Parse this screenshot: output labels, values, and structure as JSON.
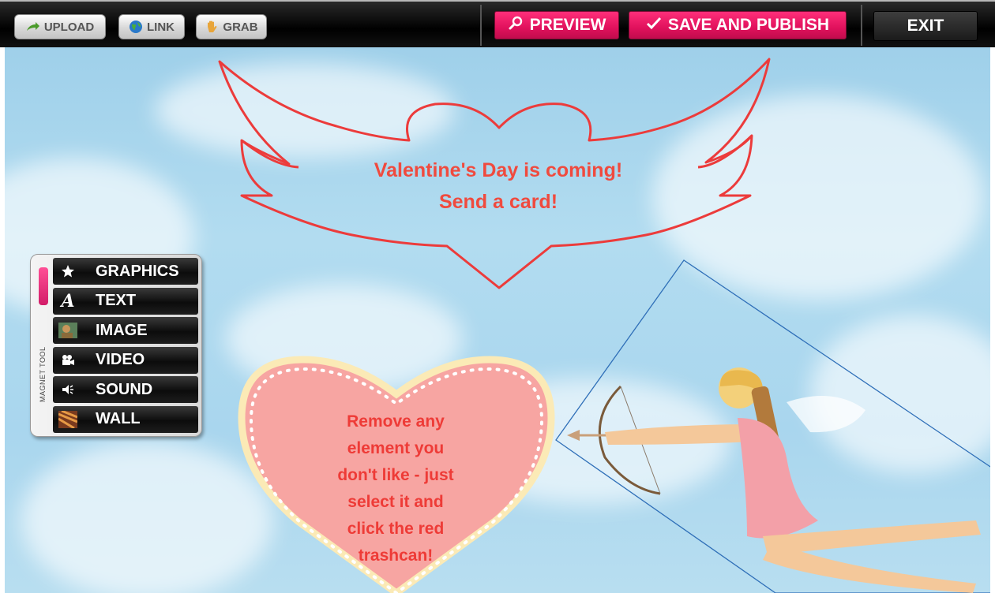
{
  "toolbar": {
    "upload_label": "UPLOAD",
    "link_label": "LINK",
    "grab_label": "GRAB",
    "preview_label": "PREVIEW",
    "save_label": "SAVE AND PUBLISH",
    "exit_label": "EXIT"
  },
  "canvas": {
    "title_line1": "Valentine's Day is coming!",
    "title_line2": "Send a card!",
    "heart_lines": [
      "Remove any",
      "element you",
      "don't like - just",
      "select it and",
      "click the red",
      "trashcan!"
    ]
  },
  "magnet_tool": {
    "label": "MAGNET TOOL",
    "items": [
      {
        "label": "GRAPHICS",
        "icon": "star-icon"
      },
      {
        "label": "TEXT",
        "icon": "text-icon"
      },
      {
        "label": "IMAGE",
        "icon": "image-icon"
      },
      {
        "label": "VIDEO",
        "icon": "video-camera-icon"
      },
      {
        "label": "SOUND",
        "icon": "speaker-icon"
      },
      {
        "label": "WALL",
        "icon": "wall-icon"
      }
    ]
  },
  "colors": {
    "accent_pink": "#e0115c",
    "title_red": "#f04a3e",
    "sky_blue": "#a9d6ee"
  }
}
